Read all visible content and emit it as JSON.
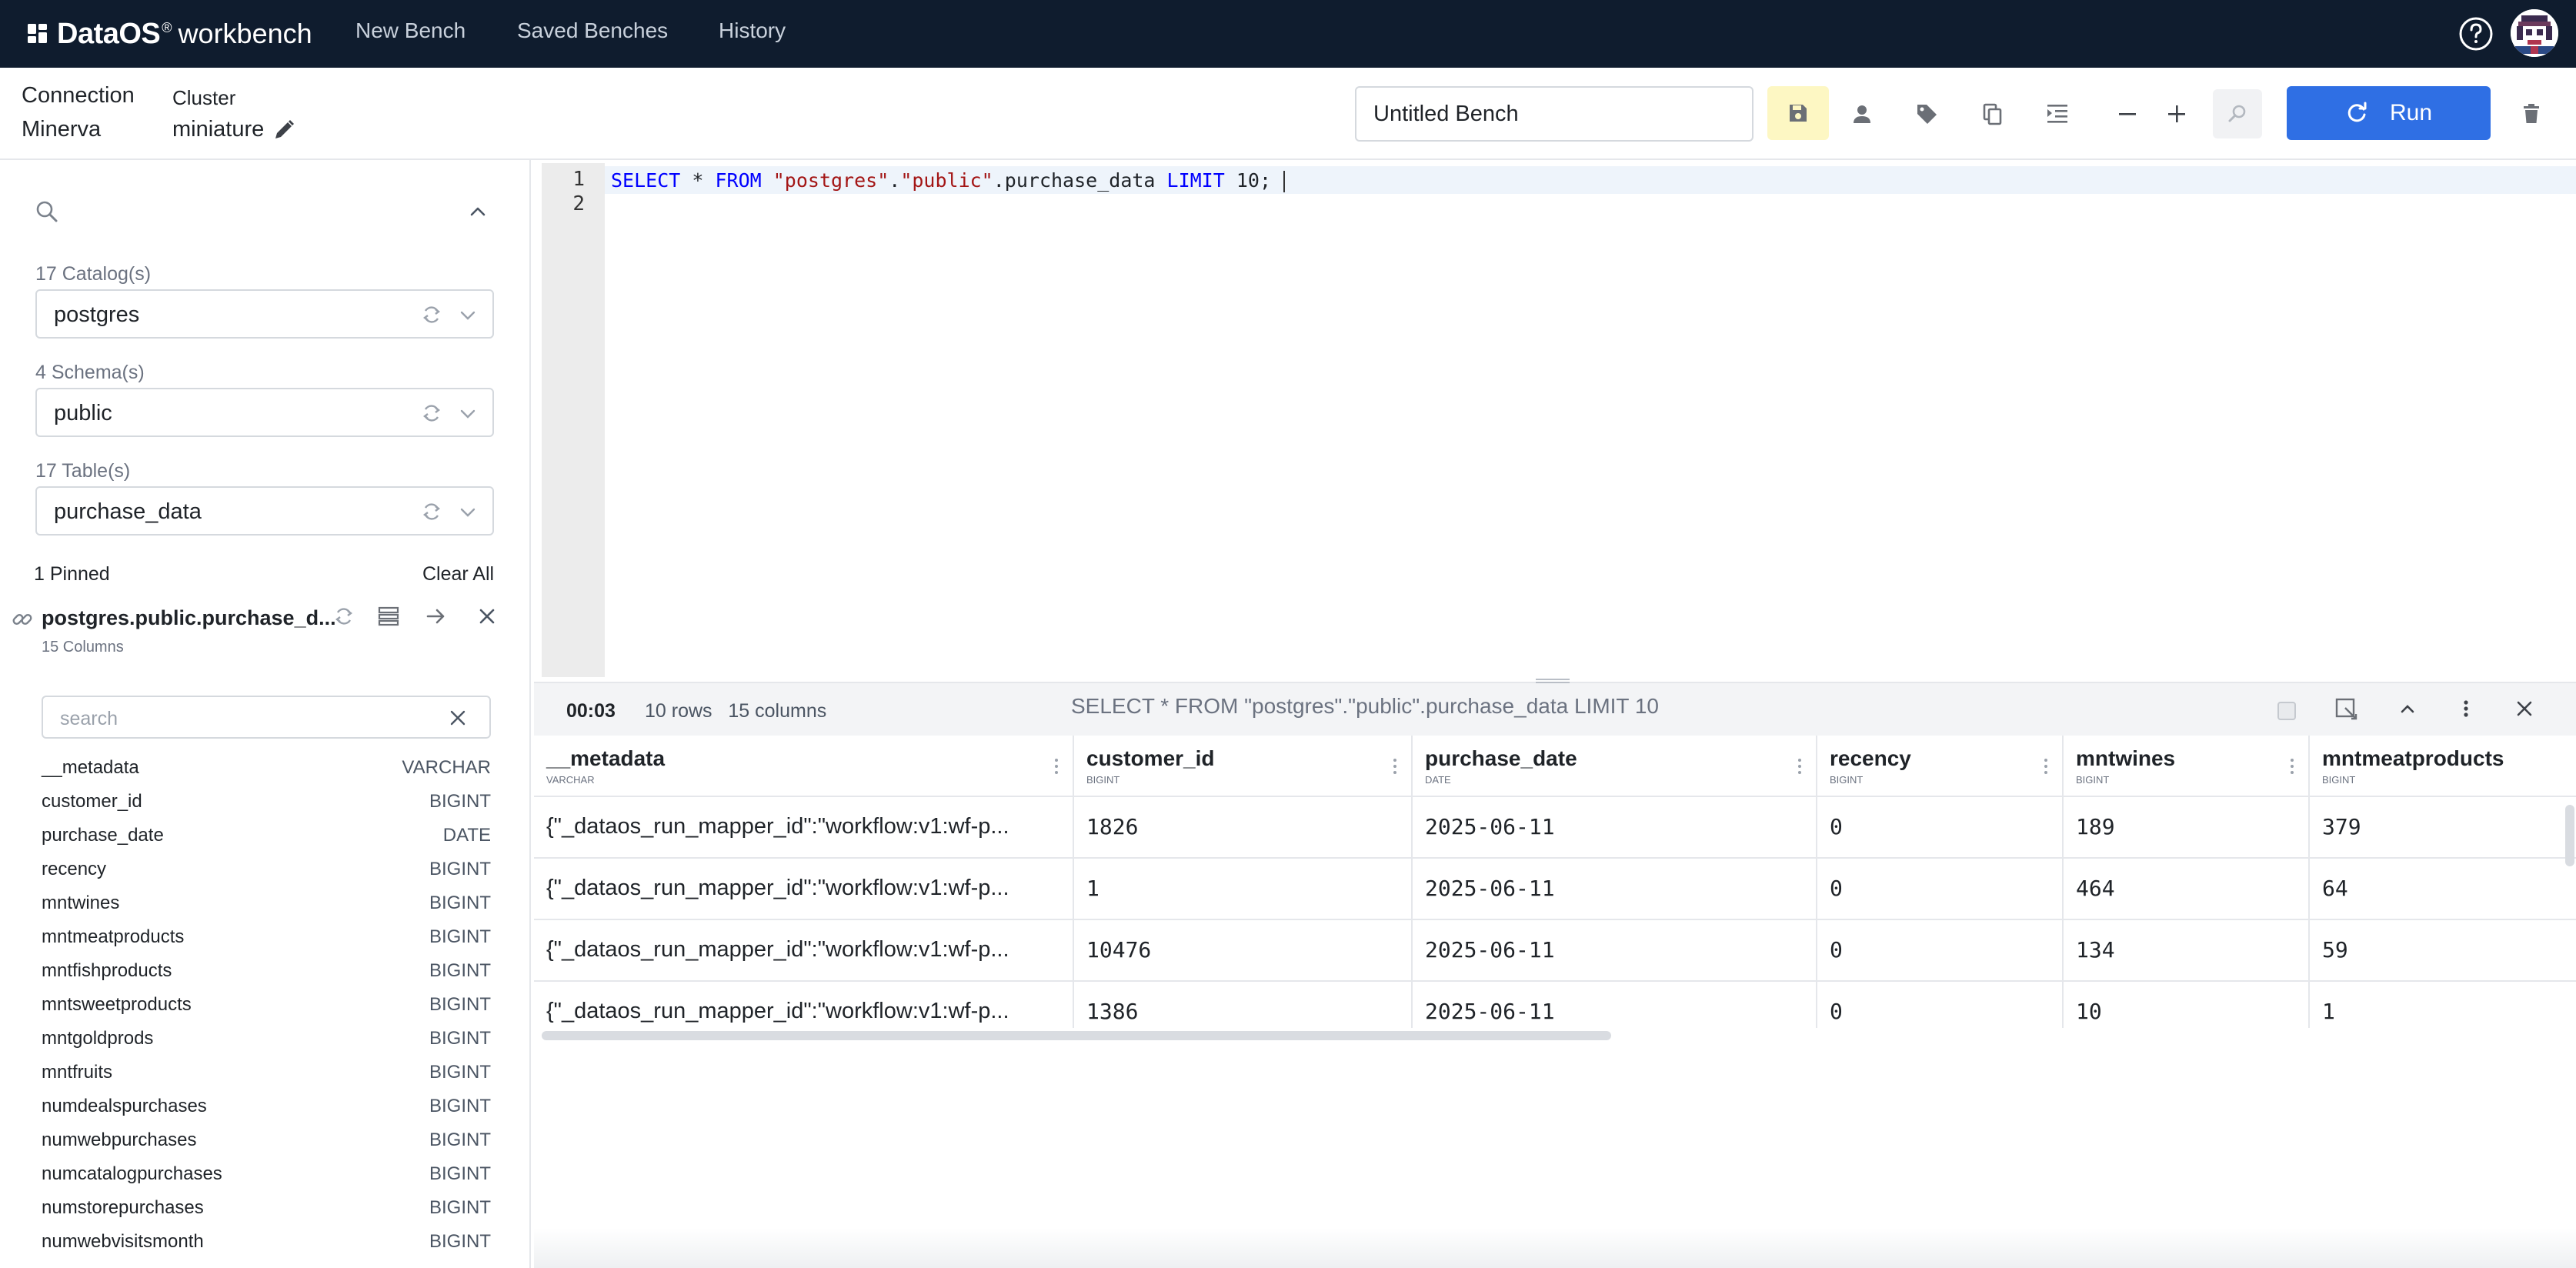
{
  "nav": {
    "brand": "DataOS",
    "brand_reg": "®",
    "brand_sub": "workbench",
    "links": [
      "New Bench",
      "Saved Benches",
      "History"
    ]
  },
  "header": {
    "connection_label": "Connection",
    "connection_value": "Minerva",
    "cluster_label": "Cluster",
    "cluster_value": "miniature",
    "bench_name": "Untitled Bench",
    "run_label": "Run"
  },
  "sidebar": {
    "catalog_label": "17 Catalog(s)",
    "catalog_value": "postgres",
    "schema_label": "4 Schema(s)",
    "schema_value": "public",
    "table_label": "17 Table(s)",
    "table_value": "purchase_data",
    "pinned_label": "1 Pinned",
    "clear_all": "Clear All",
    "pinned_table": "postgres.public.purchase_d...",
    "pinned_columns": "15 Columns",
    "column_search_placeholder": "search",
    "columns": [
      {
        "name": "__metadata",
        "type": "VARCHAR"
      },
      {
        "name": "customer_id",
        "type": "BIGINT"
      },
      {
        "name": "purchase_date",
        "type": "DATE"
      },
      {
        "name": "recency",
        "type": "BIGINT"
      },
      {
        "name": "mntwines",
        "type": "BIGINT"
      },
      {
        "name": "mntmeatproducts",
        "type": "BIGINT"
      },
      {
        "name": "mntfishproducts",
        "type": "BIGINT"
      },
      {
        "name": "mntsweetproducts",
        "type": "BIGINT"
      },
      {
        "name": "mntgoldprods",
        "type": "BIGINT"
      },
      {
        "name": "mntfruits",
        "type": "BIGINT"
      },
      {
        "name": "numdealspurchases",
        "type": "BIGINT"
      },
      {
        "name": "numwebpurchases",
        "type": "BIGINT"
      },
      {
        "name": "numcatalogpurchases",
        "type": "BIGINT"
      },
      {
        "name": "numstorepurchases",
        "type": "BIGINT"
      },
      {
        "name": "numwebvisitsmonth",
        "type": "BIGINT"
      }
    ]
  },
  "editor": {
    "line_numbers": [
      "1",
      "2"
    ],
    "tokens": {
      "select": "SELECT",
      "star": " * ",
      "from": "FROM",
      "sp": " ",
      "schema_db": "\"postgres\"",
      "dot1": ".",
      "schema_pub": "\"public\"",
      "table": ".purchase_data",
      "limit": "LIMIT",
      "tail": " 10;"
    }
  },
  "results": {
    "elapsed": "00:03",
    "rows": "10 rows",
    "columns": "15 columns",
    "query": "SELECT * FROM \"postgres\".\"public\".purchase_data LIMIT 10",
    "headers": [
      {
        "name": "__metadata",
        "type": "VARCHAR"
      },
      {
        "name": "customer_id",
        "type": "BIGINT"
      },
      {
        "name": "purchase_date",
        "type": "DATE"
      },
      {
        "name": "recency",
        "type": "BIGINT"
      },
      {
        "name": "mntwines",
        "type": "BIGINT"
      },
      {
        "name": "mntmeatproducts",
        "type": "BIGINT"
      }
    ],
    "rows_data": [
      [
        "{\"_dataos_run_mapper_id\":\"workflow:v1:wf-p...",
        "1826",
        "2025-06-11",
        "0",
        "189",
        "379"
      ],
      [
        "{\"_dataos_run_mapper_id\":\"workflow:v1:wf-p...",
        "1",
        "2025-06-11",
        "0",
        "464",
        "64"
      ],
      [
        "{\"_dataos_run_mapper_id\":\"workflow:v1:wf-p...",
        "10476",
        "2025-06-11",
        "0",
        "134",
        "59"
      ],
      [
        "{\"_dataos_run_mapper_id\":\"workflow:v1:wf-p...",
        "1386",
        "2025-06-11",
        "0",
        "10",
        "1"
      ]
    ]
  },
  "colors": {
    "nav_bg": "#0f1c2e",
    "run_button": "#2f6fe4",
    "save_button_bg": "#fdf7c3",
    "keyword": "#0000ff",
    "string": "#a31515"
  },
  "icons": {
    "nav": [
      "grid-logo-icon",
      "help-icon",
      "avatar"
    ],
    "toolbar": [
      "save-icon",
      "person-icon",
      "tag-icon",
      "copy-icon",
      "format-icon",
      "zoom-out-icon",
      "zoom-in-icon",
      "search-icon",
      "refresh-icon",
      "delete-icon"
    ],
    "results": [
      "checkbox-icon",
      "expand-icon",
      "chevron-up-icon",
      "more-vertical-icon",
      "close-icon"
    ]
  }
}
